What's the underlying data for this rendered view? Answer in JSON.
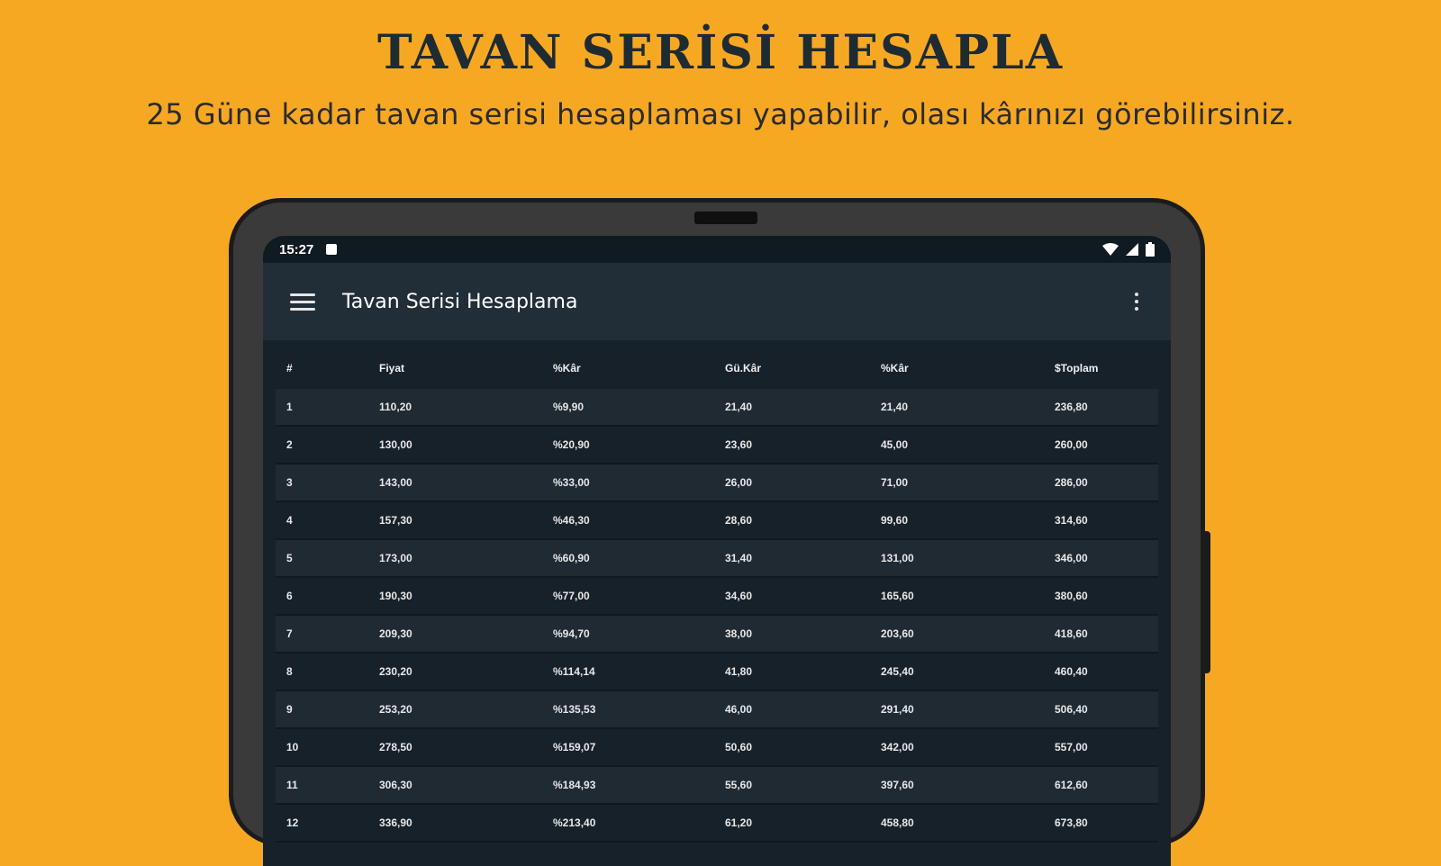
{
  "promo": {
    "title": "TAVAN SERİSİ HESAPLA",
    "subtitle": "25 Güne kadar tavan serisi hesaplaması yapabilir, olası kârınızı görebilirsiniz."
  },
  "status_bar": {
    "time": "15:27",
    "icons": [
      "notification-icon",
      "wifi-icon",
      "signal-icon",
      "battery-icon"
    ]
  },
  "app_bar": {
    "title": "Tavan Serisi Hesaplama",
    "menu_icon": "hamburger-menu-icon",
    "more_icon": "more-vert-icon"
  },
  "table": {
    "headers": [
      "#",
      "Fiyat",
      "%Kâr",
      "Gü.Kâr",
      "%Kâr",
      "$Toplam"
    ],
    "rows": [
      [
        "1",
        "110,20",
        "%9,90",
        "21,40",
        "21,40",
        "236,80"
      ],
      [
        "2",
        "130,00",
        "%20,90",
        "23,60",
        "45,00",
        "260,00"
      ],
      [
        "3",
        "143,00",
        "%33,00",
        "26,00",
        "71,00",
        "286,00"
      ],
      [
        "4",
        "157,30",
        "%46,30",
        "28,60",
        "99,60",
        "314,60"
      ],
      [
        "5",
        "173,00",
        "%60,90",
        "31,40",
        "131,00",
        "346,00"
      ],
      [
        "6",
        "190,30",
        "%77,00",
        "34,60",
        "165,60",
        "380,60"
      ],
      [
        "7",
        "209,30",
        "%94,70",
        "38,00",
        "203,60",
        "418,60"
      ],
      [
        "8",
        "230,20",
        "%114,14",
        "41,80",
        "245,40",
        "460,40"
      ],
      [
        "9",
        "253,20",
        "%135,53",
        "46,00",
        "291,40",
        "506,40"
      ],
      [
        "10",
        "278,50",
        "%159,07",
        "50,60",
        "342,00",
        "557,00"
      ],
      [
        "11",
        "306,30",
        "%184,93",
        "55,60",
        "397,60",
        "612,60"
      ],
      [
        "12",
        "336,90",
        "%213,40",
        "61,20",
        "458,80",
        "673,80"
      ]
    ]
  },
  "colors": {
    "background": "#F7A823",
    "tablet_frame": "#3A3A3A",
    "screen": "#17212A",
    "app_bar": "#222E37"
  }
}
